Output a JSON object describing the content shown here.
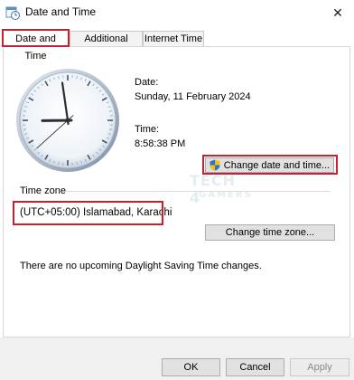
{
  "window": {
    "title": "Date and Time",
    "close_glyph": "✕"
  },
  "tabs": [
    {
      "label": "Date and Time",
      "active": true
    },
    {
      "label": "Additional Clocks",
      "active": false
    },
    {
      "label": "Internet Time",
      "active": false
    }
  ],
  "date": {
    "label": "Date:",
    "value": "Sunday, 11 February 2024"
  },
  "time": {
    "label": "Time:",
    "value": "8:58:38 PM",
    "hour": 8,
    "minute": 58,
    "second": 38
  },
  "change_datetime_button": {
    "label": "Change date and time...",
    "icon": "uac-shield-icon"
  },
  "timezone": {
    "section_label": "Time zone",
    "value": "(UTC+05:00) Islamabad, Karachi",
    "change_button_label": "Change time zone..."
  },
  "dst_message": "There are no upcoming Daylight Saving Time changes.",
  "watermark": {
    "line1": "TECH 4",
    "line2": "GAMERS"
  },
  "footer": {
    "ok": "OK",
    "cancel": "Cancel",
    "apply": "Apply"
  },
  "colors": {
    "highlight": "#c8202f",
    "watermark": "#9fc3cc"
  }
}
